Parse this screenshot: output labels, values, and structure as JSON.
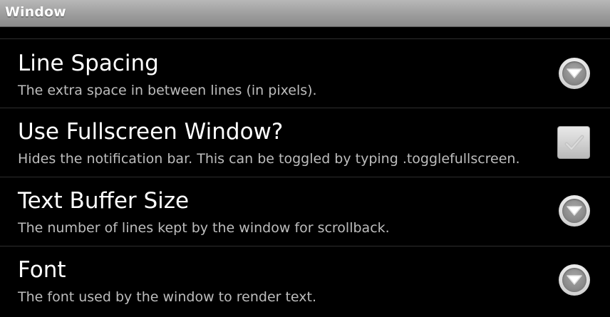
{
  "window": {
    "title": "Window"
  },
  "preferences": [
    {
      "title": "Line Spacing",
      "summary": "The extra space in between lines (in pixels).",
      "widget": "dropdown-arrow-icon"
    },
    {
      "title": "Use Fullscreen Window?",
      "summary": "Hides the notification bar. This can be toggled by typing .togglefullscreen.",
      "widget": "checkbox",
      "checked": false
    },
    {
      "title": "Text Buffer Size",
      "summary": "The number of lines kept by the window for scrollback.",
      "widget": "dropdown-arrow-icon"
    },
    {
      "title": "Font",
      "summary": "The font used by the window to render text.",
      "widget": "dropdown-arrow-icon"
    }
  ],
  "colors": {
    "background": "#000000",
    "title_text": "#ffffff",
    "summary_text": "#bdbdbd",
    "divider": "#2e2e2e"
  }
}
